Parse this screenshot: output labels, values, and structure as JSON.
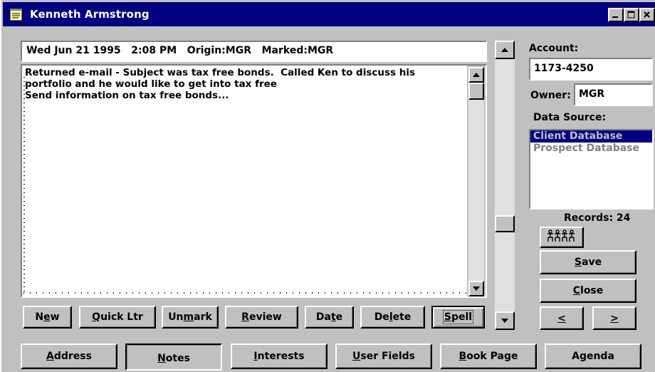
{
  "window": {
    "title": "Kenneth Armstrong"
  },
  "note": {
    "header": "Wed Jun 21 1995   2:08 PM   Origin:MGR   Marked:MGR",
    "body": "Returned e-mail - Subject was tax free bonds.  Called Ken to discuss his\nportfolio and he would like to get into tax free\nSend information on tax free bonds..."
  },
  "note_buttons": [
    {
      "pre": "N",
      "u": "e",
      "post": "w"
    },
    {
      "pre": "",
      "u": "Q",
      "post": "uick Ltr"
    },
    {
      "pre": "Un",
      "u": "m",
      "post": "ark"
    },
    {
      "pre": "",
      "u": "R",
      "post": "eview"
    },
    {
      "pre": "Da",
      "u": "t",
      "post": "e"
    },
    {
      "pre": "De",
      "u": "l",
      "post": "ete"
    },
    {
      "pre": "",
      "u": "S",
      "post": "pell"
    }
  ],
  "tabs": [
    {
      "pre": "",
      "u": "A",
      "post": "ddress"
    },
    {
      "pre": "",
      "u": "N",
      "post": "otes"
    },
    {
      "pre": "",
      "u": "I",
      "post": "nterests"
    },
    {
      "pre": "",
      "u": "U",
      "post": "ser Fields"
    },
    {
      "pre": "",
      "u": "B",
      "post": "ook Page"
    },
    {
      "pre": "A",
      "u": "g",
      "post": "enda"
    }
  ],
  "side": {
    "account_label": "Account:",
    "account_value": "1173-4250",
    "owner_label": "Owner:",
    "owner_value": "MGR",
    "data_source_label": "Data Source:",
    "data_sources": [
      "Client Database",
      "Prospect Database"
    ],
    "selected_source": "Client Database",
    "records_label": "Records: 24",
    "save": {
      "pre": "",
      "u": "S",
      "post": "ave"
    },
    "close": {
      "pre": "",
      "u": "C",
      "post": "lose"
    },
    "prev": "<",
    "next": ">"
  },
  "icons": {
    "title": "notepad-icon",
    "people": "people-group-icon"
  },
  "colors": {
    "titlebar": "#000080",
    "face": "#c0c0c0",
    "selection": "#000080"
  }
}
